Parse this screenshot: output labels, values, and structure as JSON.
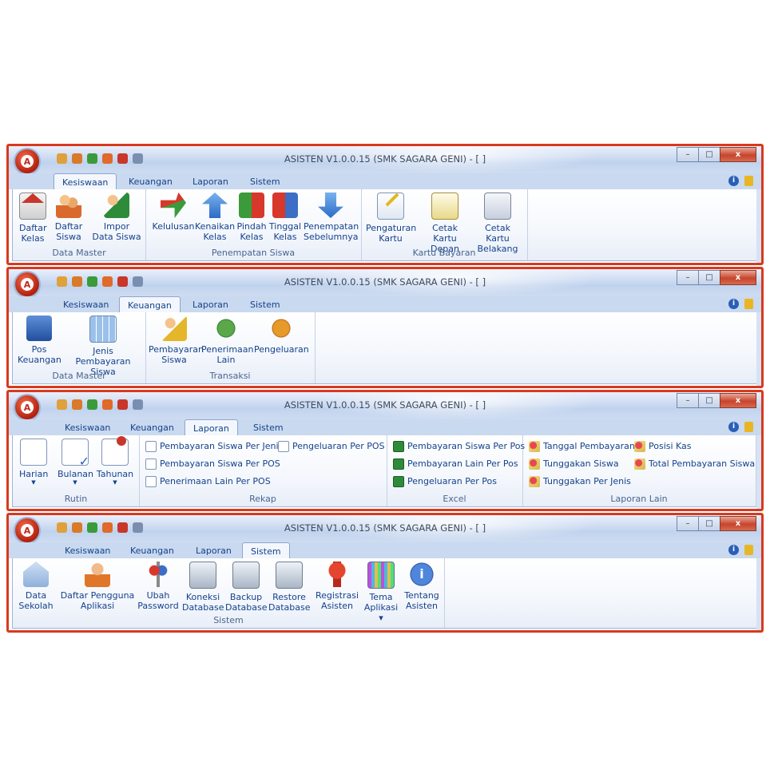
{
  "tabs": [
    "Kesiswaan",
    "Keuangan",
    "Laporan",
    "Sistem"
  ],
  "title": "ASISTEN V1.0.0.15 (SMK SAGARA GENI) - [ ]",
  "window_buttons": {
    "minimize": "–",
    "maximize": "□",
    "close": "x"
  },
  "help_icon": "i",
  "app_orb_letter": "A",
  "windows": [
    {
      "active_tab": "Kesiswaan",
      "groups": [
        {
          "label": "Data Master",
          "buttons": [
            {
              "line1": "Daftar",
              "line2": "Kelas",
              "icon": "school-icon"
            },
            {
              "line1": "Daftar",
              "line2": "Siswa",
              "icon": "students-icon"
            },
            {
              "line1": "Impor",
              "line2": "Data Siswa",
              "icon": "import-excel-icon"
            }
          ]
        },
        {
          "label": "Penempatan Siswa",
          "buttons": [
            {
              "line1": "Kelulusan",
              "line2": "",
              "icon": "graduation-arrow-icon"
            },
            {
              "line1": "Kenaikan",
              "line2": "Kelas",
              "icon": "promote-arrow-icon"
            },
            {
              "line1": "Pindah",
              "line2": "Kelas",
              "icon": "move-class-icon"
            },
            {
              "line1": "Tinggal",
              "line2": "Kelas",
              "icon": "stay-class-icon"
            },
            {
              "line1": "Penempatan",
              "line2": "Sebelumnya",
              "icon": "previous-placement-icon"
            }
          ]
        },
        {
          "label": "Kartu Bayaran",
          "buttons": [
            {
              "line1": "Pengaturan",
              "line2": "Kartu",
              "icon": "card-settings-icon"
            },
            {
              "line1": "Cetak Kartu",
              "line2": "Depan",
              "icon": "print-card-front-icon"
            },
            {
              "line1": "Cetak Kartu",
              "line2": "Belakang",
              "icon": "print-card-back-icon"
            }
          ]
        }
      ]
    },
    {
      "active_tab": "Keuangan",
      "groups": [
        {
          "label": "Data Master",
          "buttons": [
            {
              "line1": "Pos",
              "line2": "Keuangan",
              "icon": "finance-post-icon"
            },
            {
              "line1": "Jenis Pembayaran",
              "line2": "Siswa",
              "icon": "payment-type-icon"
            }
          ]
        },
        {
          "label": "Transaksi",
          "buttons": [
            {
              "line1": "Pembayaran",
              "line2": "Siswa",
              "icon": "student-payment-icon"
            },
            {
              "line1": "Penerimaan",
              "line2": "Lain",
              "icon": "other-income-icon"
            },
            {
              "line1": "Pengeluaran",
              "line2": "",
              "icon": "expense-icon"
            }
          ]
        }
      ]
    },
    {
      "active_tab": "Laporan",
      "rutin": {
        "label": "Rutin",
        "buttons": [
          "Harian",
          "Bulanan",
          "Tahunan"
        ]
      },
      "rekap": {
        "label": "Rekap",
        "items": [
          "Pembayaran Siswa Per Jenis",
          "Pembayaran Siswa Per POS",
          "Penerimaan Lain Per POS",
          "Pengeluaran Per POS"
        ]
      },
      "excel": {
        "label": "Excel",
        "items": [
          "Pembayaran Siswa Per Pos",
          "Pembayaran Lain Per Pos",
          "Pengeluaran Per Pos"
        ]
      },
      "lain": {
        "label": "Laporan Lain",
        "items": [
          "Tanggal Pembayaran",
          "Tunggakan Siswa",
          "Tunggakan Per Jenis",
          "Posisi Kas",
          "Total Pembayaran Siswa"
        ]
      }
    },
    {
      "active_tab": "Sistem",
      "groups": [
        {
          "label": "Sistem",
          "buttons": [
            {
              "line1": "Data",
              "line2": "Sekolah",
              "icon": "school-data-icon"
            },
            {
              "line1": "Daftar Pengguna",
              "line2": "Aplikasi",
              "icon": "users-icon"
            },
            {
              "line1": "Ubah",
              "line2": "Password",
              "icon": "keys-icon"
            },
            {
              "line1": "Koneksi",
              "line2": "Database",
              "icon": "db-connect-icon"
            },
            {
              "line1": "Backup",
              "line2": "Database",
              "icon": "db-backup-icon"
            },
            {
              "line1": "Restore",
              "line2": "Database",
              "icon": "db-restore-icon"
            },
            {
              "line1": "Registrasi",
              "line2": "Asisten",
              "icon": "registration-icon"
            },
            {
              "line1": "Tema",
              "line2": "Aplikasi ▾",
              "icon": "theme-icon"
            },
            {
              "line1": "Tentang",
              "line2": "Asisten",
              "icon": "about-icon"
            }
          ]
        }
      ]
    }
  ]
}
